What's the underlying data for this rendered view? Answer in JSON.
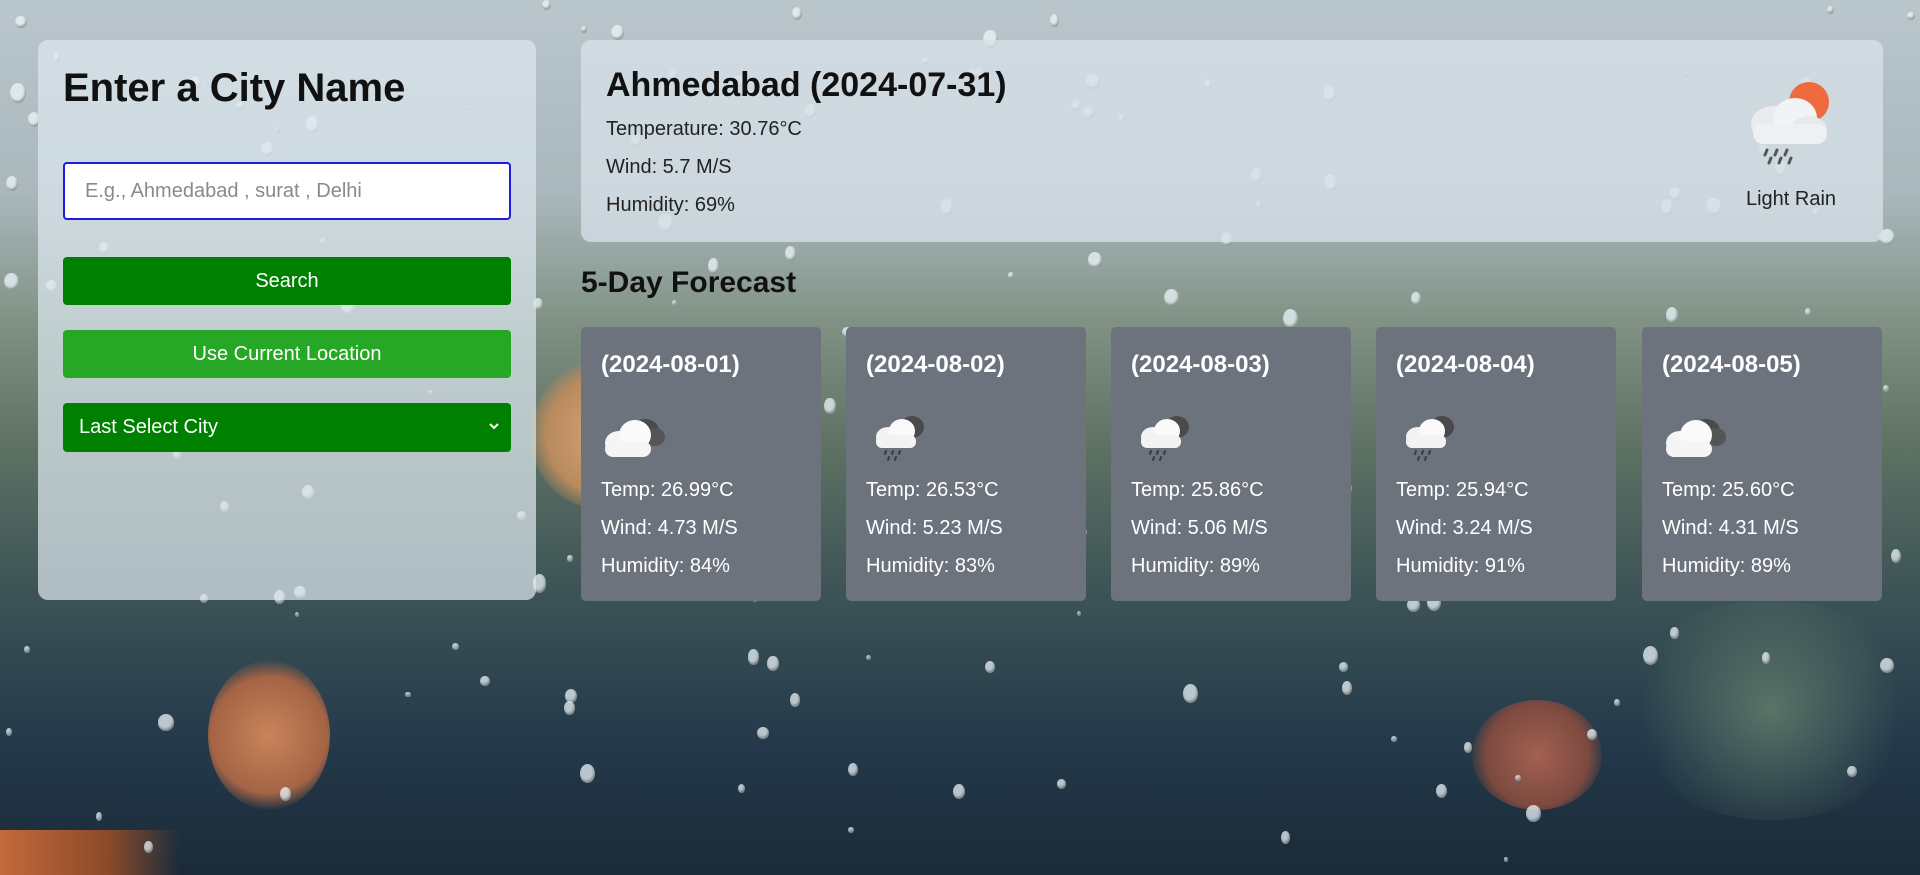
{
  "sidebar": {
    "title": "Enter a City Name",
    "search_placeholder": "E.g., Ahmedabad , surat , Delhi",
    "search_value": "",
    "search_label": "Search",
    "location_label": "Use Current Location",
    "last_city_select": {
      "selected": "Last Select City"
    }
  },
  "current": {
    "heading": "Ahmedabad (2024-07-31)",
    "temperature": "Temperature: 30.76°C",
    "wind": "Wind: 5.7 M/S",
    "humidity": "Humidity: 69%",
    "condition": "Light Rain",
    "icon": "light-rain-sun-icon"
  },
  "forecast": {
    "title": "5-Day Forecast",
    "days": [
      {
        "date": "(2024-08-01)",
        "icon": "broken-clouds-icon",
        "temp": "Temp: 26.99°C",
        "wind": "Wind: 4.73 M/S",
        "humidity": "Humidity: 84%"
      },
      {
        "date": "(2024-08-02)",
        "icon": "rain-clouds-icon",
        "temp": "Temp: 26.53°C",
        "wind": "Wind: 5.23 M/S",
        "humidity": "Humidity: 83%"
      },
      {
        "date": "(2024-08-03)",
        "icon": "rain-clouds-icon",
        "temp": "Temp: 25.86°C",
        "wind": "Wind: 5.06 M/S",
        "humidity": "Humidity: 89%"
      },
      {
        "date": "(2024-08-04)",
        "icon": "rain-clouds-icon",
        "temp": "Temp: 25.94°C",
        "wind": "Wind: 3.24 M/S",
        "humidity": "Humidity: 91%"
      },
      {
        "date": "(2024-08-05)",
        "icon": "broken-clouds-icon",
        "temp": "Temp: 25.60°C",
        "wind": "Wind: 4.31 M/S",
        "humidity": "Humidity: 89%"
      }
    ]
  },
  "colors": {
    "primary_button": "#008000",
    "secondary_button": "#26a826",
    "card_background": "#6c737d",
    "input_border": "#1d1de0"
  }
}
